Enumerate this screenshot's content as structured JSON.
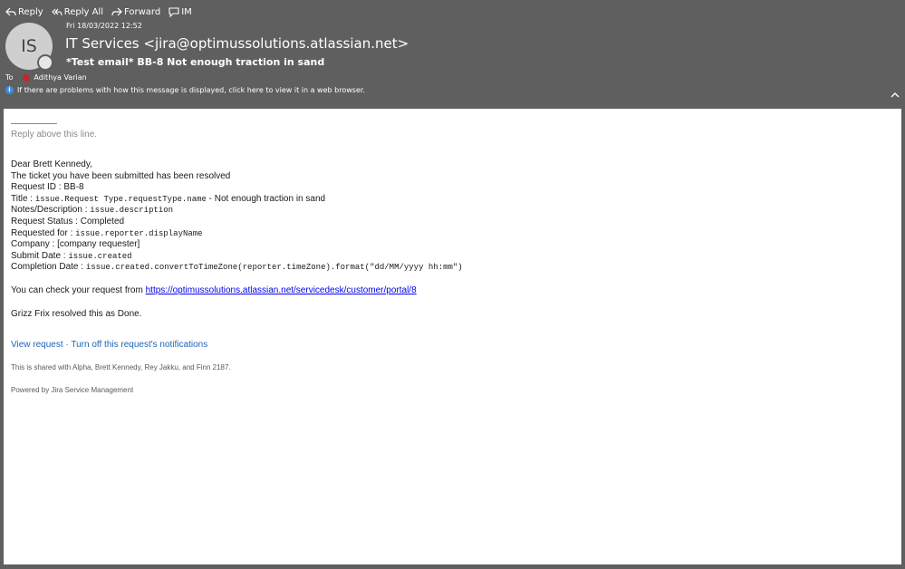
{
  "toolbar": {
    "reply": "Reply",
    "reply_all": "Reply All",
    "forward": "Forward",
    "im": "IM"
  },
  "header": {
    "avatar_initials": "IS",
    "date": "Fri 18/03/2022 12:52",
    "sender": "IT Services <jira@optimussolutions.atlassian.net>",
    "subject": "*Test email* BB-8 Not enough traction in sand",
    "to_label": "To",
    "recipient": "Adithya Varian",
    "info_text": "If there are problems with how this message is displayed, click here to view it in a web browser."
  },
  "email": {
    "reply_above": "Reply above this line.",
    "greeting": "Dear Brett Kennedy,",
    "intro": "The ticket you have been submitted has been resolved",
    "fields": [
      {
        "label": "Request ID : ",
        "mono": "",
        "value": "BB-8"
      },
      {
        "label": "Title : ",
        "mono": "issue.Request Type.requestType.name",
        "value": " - Not enough traction in sand"
      },
      {
        "label": "Notes/Description : ",
        "mono": "issue.description",
        "value": ""
      },
      {
        "label": "Request Status : ",
        "mono": "",
        "value": "Completed"
      },
      {
        "label": "Requested for : ",
        "mono": "issue.reporter.displayName",
        "value": ""
      },
      {
        "label": "Company : ",
        "mono": "",
        "value": "[company requester]"
      },
      {
        "label": "Submit Date : ",
        "mono": "issue.created",
        "value": ""
      },
      {
        "label": "Completion Date : ",
        "mono": "issue.created.convertToTimeZone(reporter.timeZone).format(\"dd/MM/yyyy hh:mm\")",
        "value": ""
      }
    ],
    "check_text": "You can check your request from ",
    "portal_url": "https://optimussolutions.atlassian.net/servicedesk/customer/portal/8",
    "resolved_text": "Grizz Frix resolved this as Done.",
    "view_request": "View request",
    "separator": " · ",
    "turn_off": "Turn off this request's notifications",
    "shared_with": "This is shared with Alpha, Brett Kennedy, Rey Jakku, and Finn 2187.",
    "powered_by": "Powered by Jira Service Management"
  },
  "colors": {
    "header_bg": "#5f5f5f",
    "link": "#2065b5",
    "presence_red": "#c4262e"
  }
}
